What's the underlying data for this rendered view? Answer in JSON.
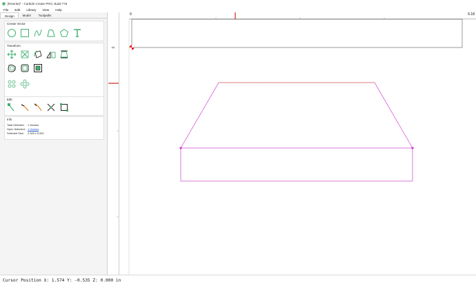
{
  "window": {
    "title": "[Rewrite]* - Carbide Create PRO, Build 778"
  },
  "menu": [
    {
      "label": "File"
    },
    {
      "label": "Edit"
    },
    {
      "label": "Library"
    },
    {
      "label": "View"
    },
    {
      "label": "Help"
    }
  ],
  "tabs": [
    {
      "label": "Design",
      "active": true
    },
    {
      "label": "Model",
      "active": false
    },
    {
      "label": "Toolpaths",
      "active": false
    }
  ],
  "groups": {
    "create_vector": {
      "title": "Create Vector"
    },
    "transform": {
      "title": "Transform"
    },
    "edit": {
      "title": "Edit"
    },
    "info": {
      "title": "Info",
      "rows": [
        {
          "key": "Total Selected:",
          "value": "1 Vectors"
        },
        {
          "key": "Open Selected:",
          "value": "1 Vectors"
        },
        {
          "key": "Selected Size:",
          "value": "2.345 x 0.000"
        }
      ]
    }
  },
  "ruler": {
    "start": "0",
    "end": "5.18"
  },
  "status": {
    "text": "Cursor Position X: 1.574 Y: -0.535 Z: 0.000 in"
  },
  "colors": {
    "accent": "#40b070",
    "shape": "#d040d0",
    "orange": "#e08a2a",
    "ruler_marker": "#d02020"
  },
  "icons": {
    "create_vector": [
      "circle-icon",
      "rectangle-icon",
      "curve-icon",
      "polyline-icon",
      "polygon-icon",
      "text-icon"
    ],
    "transform_row1": [
      "move-icon",
      "scale-icon",
      "rotate-icon",
      "mirror-icon",
      "align-icon"
    ],
    "transform_row2": [
      "offset-icon",
      "boolean-icon",
      "group-icon"
    ],
    "transform_row3": [
      "circular-array-icon",
      "linear-array-icon"
    ],
    "edit": [
      "node-edit-icon",
      "trim-icon",
      "fillet-icon",
      "delete-icon",
      "select-box-icon"
    ]
  }
}
